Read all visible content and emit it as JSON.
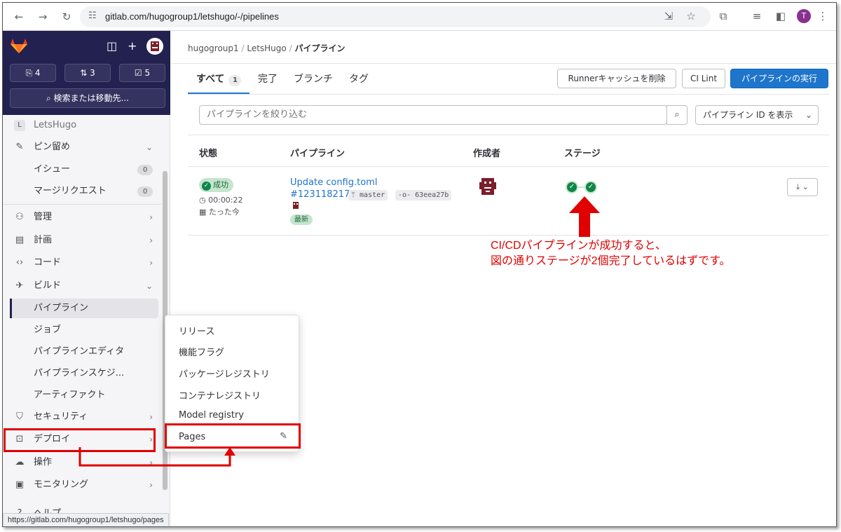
{
  "browser": {
    "url": "gitlab.com/hugogroup1/letshugo/-/pipelines",
    "profile_initial": "T"
  },
  "sidebar": {
    "counts": {
      "issues": "4",
      "merge_requests": "3",
      "todos": "5"
    },
    "search_label": "検索または移動先...",
    "project_initial": "L",
    "project_name": "LetsHugo",
    "pinned": {
      "label": "ピン留め",
      "items": [
        {
          "label": "イシュー",
          "count": "0"
        },
        {
          "label": "マージリクエスト",
          "count": "0"
        }
      ]
    },
    "manage": "管理",
    "plan": "計画",
    "code": "コード",
    "build": "ビルド",
    "build_items": [
      "パイプライン",
      "ジョブ",
      "パイプラインエディタ",
      "パイプラインスケジ...",
      "アーティファクト"
    ],
    "security": "セキュリティ",
    "deploy": "デプロイ",
    "operate": "操作",
    "monitor": "モニタリング",
    "help": "ヘルプ"
  },
  "status_url": "https://gitlab.com/hugogroup1/letshugo/pages",
  "breadcrumb": {
    "group": "hugogroup1",
    "project": "LetsHugo",
    "current": "パイプライン"
  },
  "tabs": [
    {
      "label": "すべて",
      "count": "1"
    },
    {
      "label": "完了"
    },
    {
      "label": "ブランチ"
    },
    {
      "label": "タグ"
    }
  ],
  "buttons": {
    "clear_cache": "Runnerキャッシュを削除",
    "ci_lint": "CI Lint",
    "run_pipeline": "パイプラインの実行"
  },
  "filter": {
    "placeholder": "パイプラインを絞り込む",
    "id_dropdown": "パイプライン ID を表示"
  },
  "table": {
    "headers": {
      "status": "状態",
      "pipeline": "パイプライン",
      "author": "作成者",
      "stages": "ステージ"
    },
    "row": {
      "status": "成功",
      "duration": "00:00:22",
      "finished": "たった今",
      "title": "Update config.toml",
      "id": "#1231182172",
      "branch": "master",
      "commit": "63eea27b",
      "badge": "最新"
    }
  },
  "annotation": {
    "line1": "CI/CDパイプラインが成功すると、",
    "line2": "図の通りステージが2個完了しているはずです。"
  },
  "flyout": [
    "リリース",
    "機能フラグ",
    "パッケージレジストリ",
    "コンテナレジストリ",
    "Model registry",
    "Pages"
  ],
  "colors": {
    "gitlab_nav": "#232150",
    "primary": "#1f75cb",
    "success": "#108548",
    "annotation_red": "#e00000"
  }
}
